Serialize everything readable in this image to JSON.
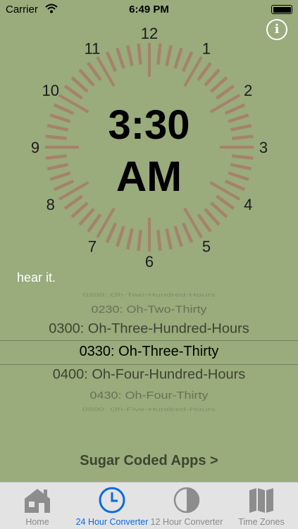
{
  "status_bar": {
    "carrier": "Carrier",
    "time": "6:49 PM"
  },
  "info_button": {
    "label": "i"
  },
  "clock": {
    "numbers": [
      "12",
      "1",
      "2",
      "3",
      "4",
      "5",
      "6",
      "7",
      "8",
      "9",
      "10",
      "11"
    ],
    "time_text": "3:30",
    "ampm_text": "AM"
  },
  "hear_it": "hear it.",
  "picker": {
    "items": [
      "0200: Oh-Two-Hundred-Hours",
      "0230: Oh-Two-Thirty",
      "0300: Oh-Three-Hundred-Hours",
      "0330: Oh-Three-Thirty",
      "0400: Oh-Four-Hundred-Hours",
      "0430: Oh-Four-Thirty",
      "0500: Oh-Five-Hundred-Hours"
    ],
    "selected_index": 3
  },
  "promo_link": "Sugar Coded Apps >",
  "tabs": [
    {
      "label": "Home",
      "icon": "house-icon"
    },
    {
      "label": "24 Hour Converter",
      "icon": "clock-icon"
    },
    {
      "label": "12 Hour Converter",
      "icon": "half-circle-icon"
    },
    {
      "label": "Time Zones",
      "icon": "map-icon"
    }
  ],
  "colors": {
    "background": "#9aab7c",
    "tick": "#a5826b",
    "accent": "#0a6ae0",
    "tab_inactive": "#8a8a8a"
  }
}
